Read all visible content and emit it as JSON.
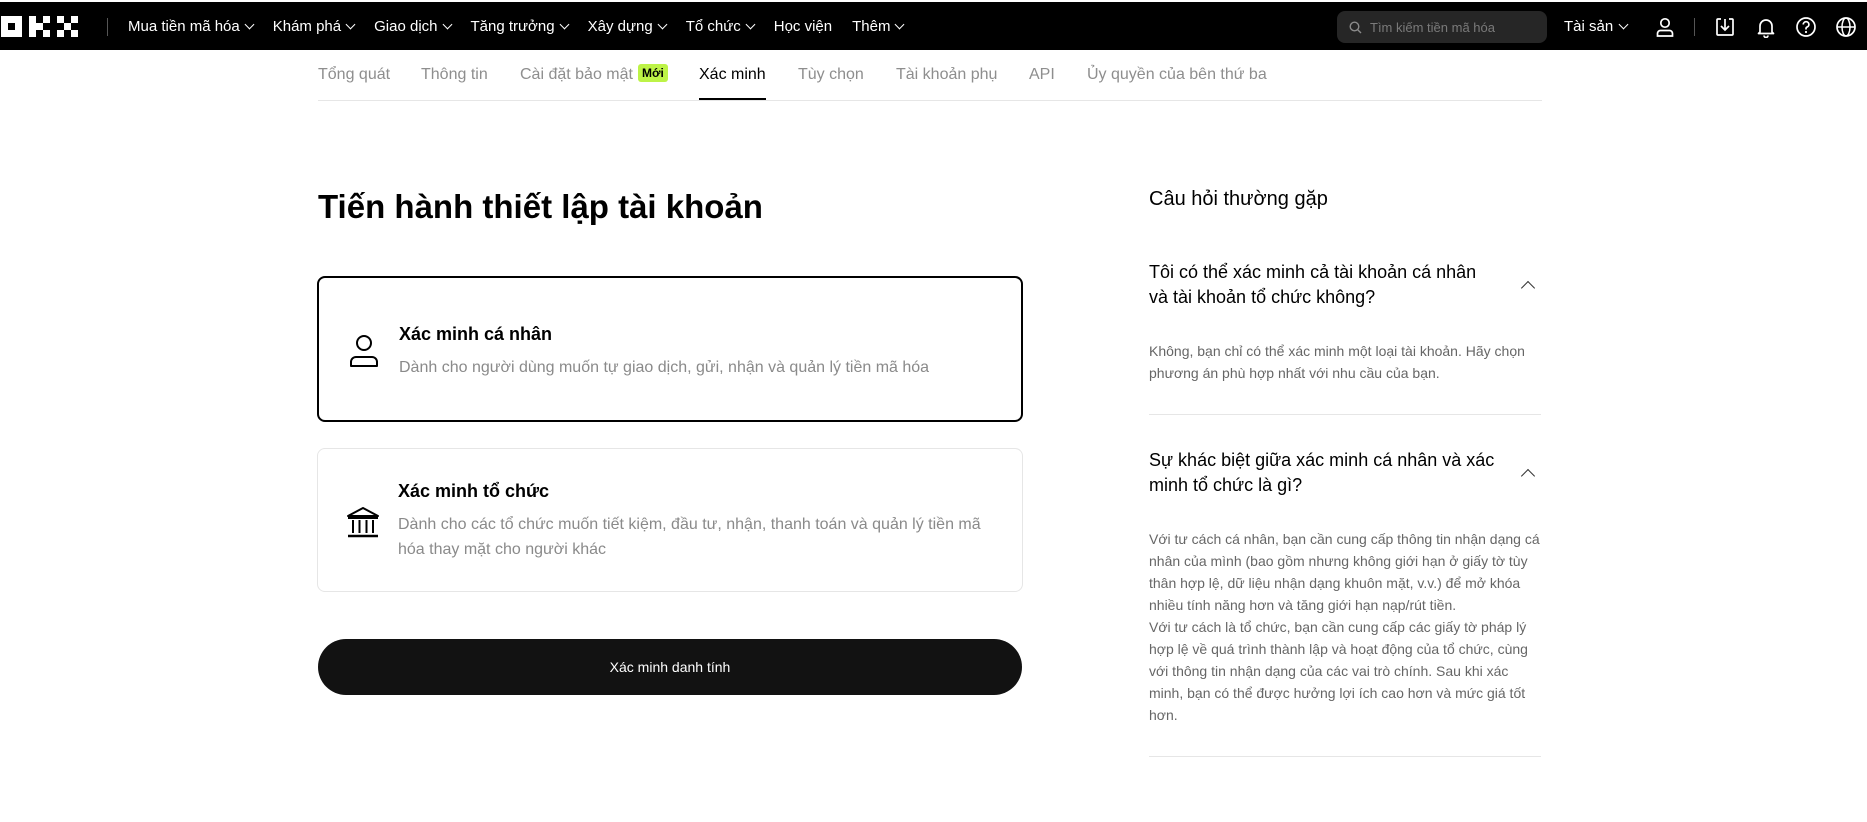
{
  "header": {
    "logo_icon": "okx-logo",
    "nav": [
      {
        "label": "Mua tiền mã hóa",
        "has_dropdown": true
      },
      {
        "label": "Khám phá",
        "has_dropdown": true
      },
      {
        "label": "Giao dịch",
        "has_dropdown": true
      },
      {
        "label": "Tăng trưởng",
        "has_dropdown": true
      },
      {
        "label": "Xây dựng",
        "has_dropdown": true
      },
      {
        "label": "Tổ chức",
        "has_dropdown": true
      },
      {
        "label": "Học viện",
        "has_dropdown": false
      },
      {
        "label": "Thêm",
        "has_dropdown": true
      }
    ],
    "search_placeholder": "Tìm kiếm tiền mã hóa",
    "assets_label": "Tài sản",
    "icons": [
      "user-icon",
      "download-icon",
      "bell-icon",
      "help-icon",
      "globe-icon"
    ]
  },
  "tabs": {
    "items": [
      {
        "label": "Tổng quát"
      },
      {
        "label": "Thông tin"
      },
      {
        "label": "Cài đặt bảo mật",
        "badge": "Mới"
      },
      {
        "label": "Xác minh",
        "active": true
      },
      {
        "label": "Tùy chọn"
      },
      {
        "label": "Tài khoản phụ"
      },
      {
        "label": "API"
      },
      {
        "label": "Ủy quyền của bên thứ ba"
      }
    ]
  },
  "main": {
    "title": "Tiến hành thiết lập tài khoản",
    "options": [
      {
        "icon": "person-icon",
        "title": "Xác minh cá nhân",
        "description": "Dành cho người dùng muốn tự giao dịch, gửi, nhận và quản lý tiền mã hóa",
        "selected": true
      },
      {
        "icon": "institution-icon",
        "title": "Xác minh tổ chức",
        "description": "Dành cho các tổ chức muốn tiết kiệm, đầu tư, nhận, thanh toán và quản lý tiền mã hóa thay mặt cho người khác",
        "selected": false
      }
    ],
    "cta_label": "Xác minh danh tính"
  },
  "faq": {
    "title": "Câu hỏi thường gặp",
    "items": [
      {
        "question": "Tôi có thể xác minh cả tài khoản cá nhân và tài khoản tổ chức không?",
        "answer": "Không, bạn chỉ có thể xác minh một loại tài khoản. Hãy chọn phương án phù hợp nhất với nhu cầu của bạn.",
        "expanded": true
      },
      {
        "question": "Sự khác biệt giữa xác minh cá nhân và xác minh tổ chức là gì?",
        "answer": "Với tư cách cá nhân, bạn cần cung cấp thông tin nhận dạng cá nhân của mình (bao gồm nhưng không giới hạn ở giấy tờ tùy thân hợp lệ, dữ liệu nhận dạng khuôn mặt, v.v.) để mở khóa nhiều tính năng hơn và tăng giới hạn nạp/rút tiền.",
        "answer_2": "Với tư cách là tổ chức, bạn cần cung cấp các giấy tờ pháp lý hợp lệ về quá trình thành lập và hoạt động của tổ chức, cùng với thông tin nhận dạng của các vai trò chính. Sau khi xác minh, bạn có thể được hưởng lợi ích cao hơn và mức giá tốt hơn.",
        "expanded": true
      }
    ]
  }
}
